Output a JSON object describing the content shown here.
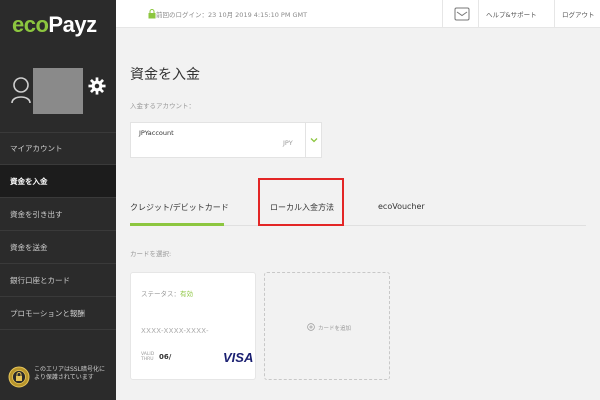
{
  "brand": {
    "logo_part1": "eco",
    "logo_part2": "Payz",
    "accent": "#8cc63f",
    "sidebar_bg": "#2b2b2b"
  },
  "profile": {
    "avatar": "user-avatar",
    "settings_icon": "gear-icon"
  },
  "sidebar": {
    "items": [
      {
        "label": "マイアカウント",
        "active": false
      },
      {
        "label": "資金を入金",
        "active": true
      },
      {
        "label": "資金を引き出す",
        "active": false
      },
      {
        "label": "資金を送金",
        "active": false
      },
      {
        "label": "銀行口座とカード",
        "active": false
      },
      {
        "label": "プロモーションと報酬",
        "active": false
      }
    ],
    "ssl_text": "このエリアはSSL暗号化により保護されています"
  },
  "topbar": {
    "last_login": "前回のログイン：23 10月 2019 4:15:10 PM GMT",
    "help": "ヘルプ&サポート",
    "logout": "ログアウト"
  },
  "main": {
    "title": "資金を入金",
    "account_label": "入金するアカウント：",
    "account": {
      "name": "JPYaccount",
      "currency": "JPY"
    },
    "tabs": [
      {
        "label": "クレジット/デビットカード",
        "active": true
      },
      {
        "label": "ローカル入金方法",
        "active": false,
        "highlighted": true
      },
      {
        "label": "ecoVoucher",
        "active": false
      }
    ],
    "highlight_color": "#e32626",
    "card_select_label": "カードを選択:",
    "card": {
      "status_label": "ステータス：",
      "status_value": "有効",
      "number": "XXXX-XXXX-XXXX-",
      "valid_thru": "VALID THRU",
      "expiry": "06/",
      "network": "VISA"
    },
    "add_card_label": "カードを追加"
  }
}
